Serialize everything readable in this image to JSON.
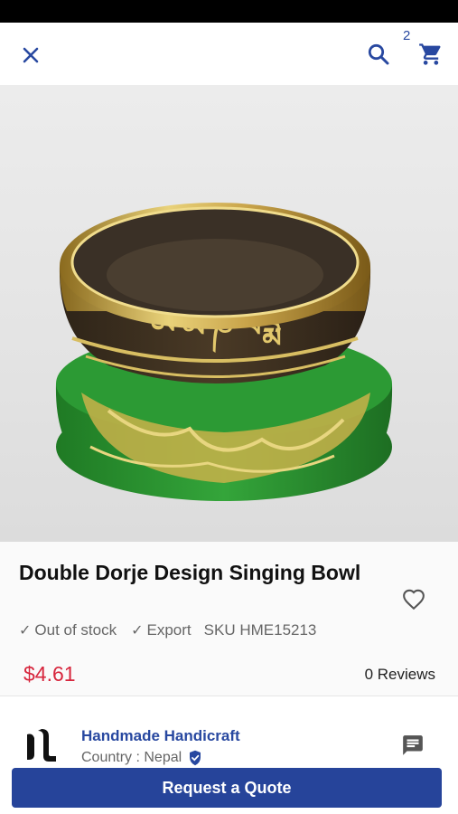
{
  "header": {
    "cart_count": "2",
    "icons": {
      "close": "close-icon",
      "search": "search-icon",
      "cart": "cart-icon"
    },
    "accent_color": "#2848a0"
  },
  "product": {
    "title": "Double Dorje Design Singing Bowl",
    "stock_status": "Out of stock",
    "export_label": "Export",
    "sku": "SKU HME15213",
    "price": "$4.61",
    "price_color": "#d7263d",
    "reviews": "0 Reviews",
    "image_alt": "singing-bowl-photo"
  },
  "seller": {
    "name": "Handmade Handicraft",
    "country": "Country : Nepal"
  },
  "actions": {
    "request_quote": "Request a Quote",
    "button_color": "#26449a"
  }
}
